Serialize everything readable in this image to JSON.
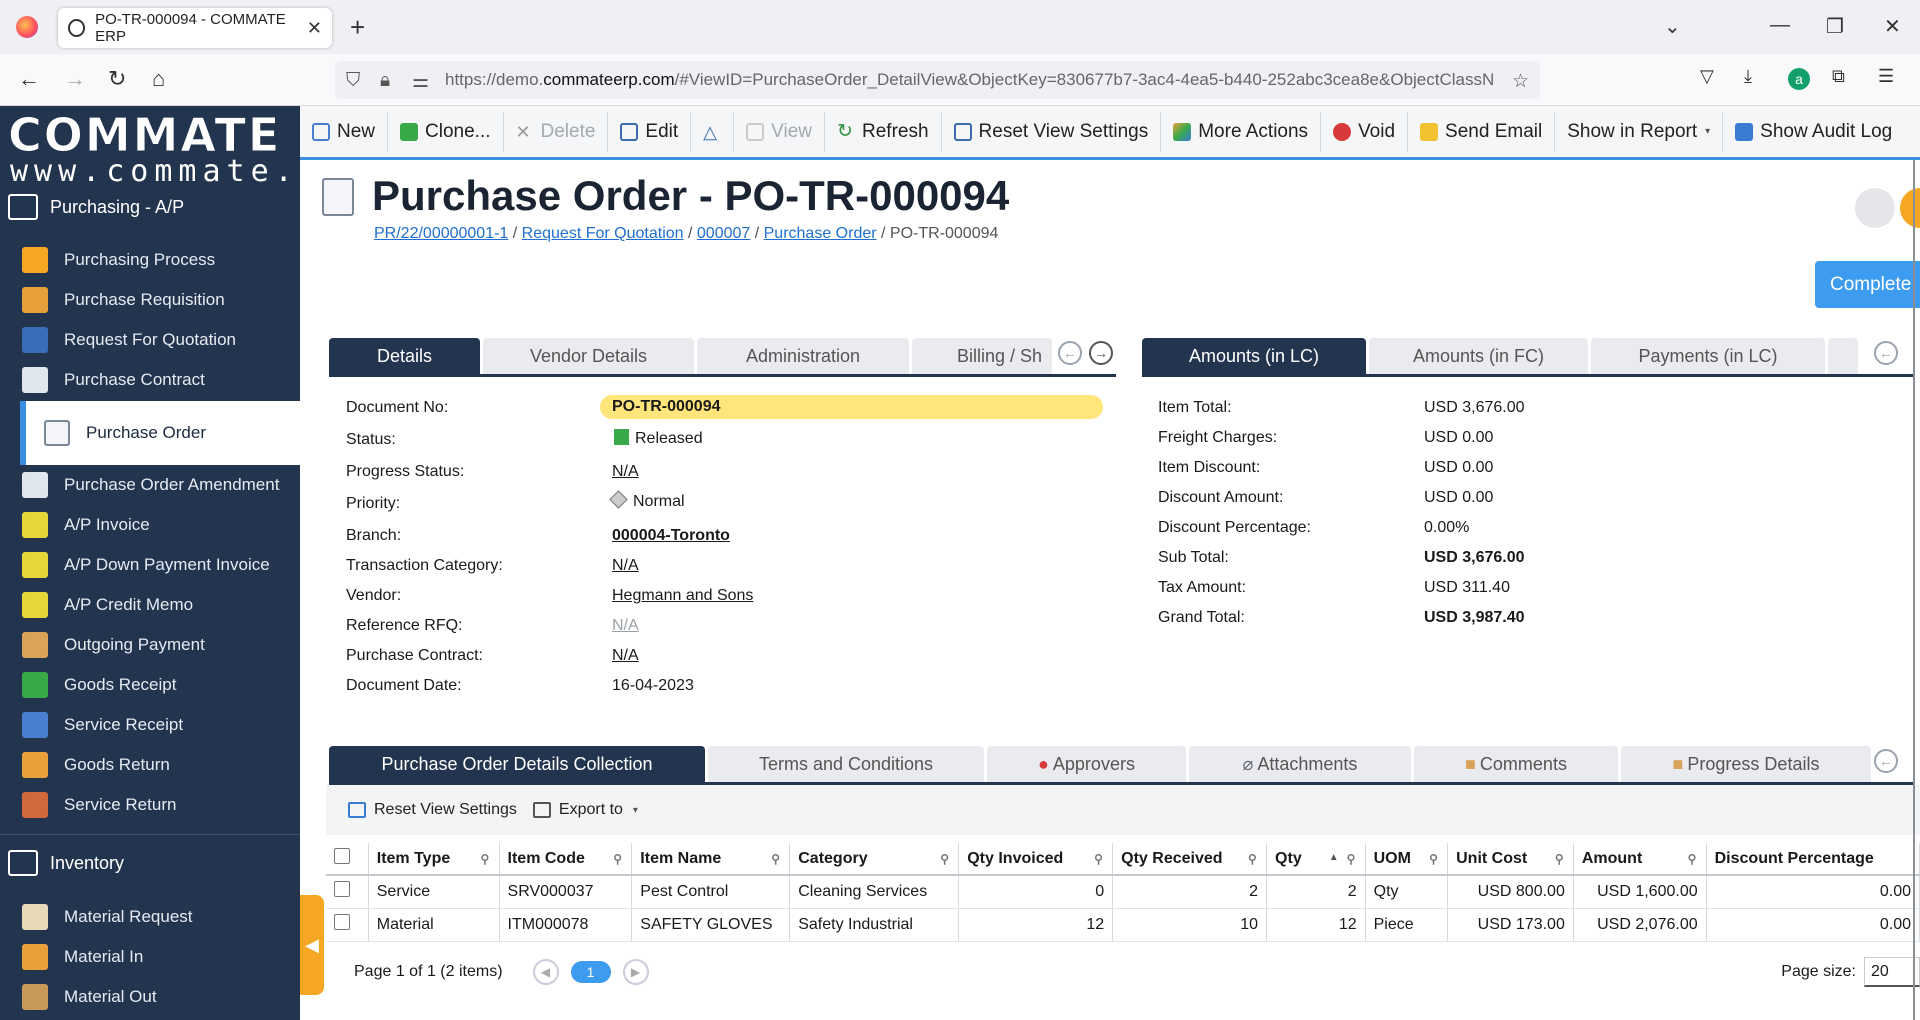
{
  "browser": {
    "tab_title": "PO-TR-000094 - COMMATE ERP",
    "url_prefix": "https://demo.",
    "url_host": "commateerp.com",
    "url_rest": "/#ViewID=PurchaseOrder_DetailView&ObjectKey=830677b7-3ac4-4ea5-b440-252abc3cea8e&ObjectClassN"
  },
  "sidebar": {
    "logo": "COMMATE",
    "logo_sub": "www.commate.ca",
    "section_purchasing": "Purchasing - A/P",
    "items": [
      {
        "label": "Purchasing Process"
      },
      {
        "label": "Purchase Requisition"
      },
      {
        "label": "Request For Quotation"
      },
      {
        "label": "Purchase Contract"
      },
      {
        "label": "Purchase Order"
      },
      {
        "label": "Purchase Order Amendment"
      },
      {
        "label": "A/P Invoice"
      },
      {
        "label": "A/P Down Payment Invoice"
      },
      {
        "label": "A/P Credit Memo"
      },
      {
        "label": "Outgoing Payment"
      },
      {
        "label": "Goods Receipt"
      },
      {
        "label": "Service Receipt"
      },
      {
        "label": "Goods Return"
      },
      {
        "label": "Service Return"
      }
    ],
    "section_inventory": "Inventory",
    "inv_items": [
      {
        "label": "Material Request"
      },
      {
        "label": "Material In"
      },
      {
        "label": "Material Out"
      }
    ]
  },
  "toolbar": {
    "new": "New",
    "clone": "Clone...",
    "delete": "Delete",
    "edit": "Edit",
    "view": "View",
    "refresh": "Refresh",
    "reset_view": "Reset View Settings",
    "more_actions": "More Actions",
    "void": "Void",
    "send_email": "Send Email",
    "show_in_report": "Show in Report",
    "show_audit_log": "Show Audit Log"
  },
  "header": {
    "title": "Purchase Order - PO-TR-000094",
    "crumbs": [
      "PR/22/00000001-1",
      "Request For Quotation",
      "000007",
      "Purchase Order"
    ],
    "crumb_current": "PO-TR-000094",
    "complete_label": "Complete"
  },
  "left_tabs": [
    "Details",
    "Vendor Details",
    "Administration",
    "Billing / Sh"
  ],
  "right_tabs": [
    "Amounts (in LC)",
    "Amounts (in FC)",
    "Payments (in LC)"
  ],
  "details": {
    "document_no_label": "Document No:",
    "document_no": "PO-TR-000094",
    "status_label": "Status:",
    "status": "Released",
    "progress_label": "Progress Status:",
    "progress": "N/A",
    "priority_label": "Priority:",
    "priority": "Normal",
    "branch_label": "Branch:",
    "branch": "000004-Toronto",
    "txn_cat_label": "Transaction Category:",
    "txn_cat": "N/A",
    "vendor_label": "Vendor:",
    "vendor": "Hegmann and Sons",
    "ref_rfq_label": "Reference RFQ:",
    "ref_rfq": "N/A",
    "contract_label": "Purchase Contract:",
    "contract": "N/A",
    "doc_date_label": "Document Date:",
    "doc_date": "16-04-2023"
  },
  "amounts": {
    "item_total_label": "Item Total:",
    "item_total": "USD 3,676.00",
    "freight_label": "Freight Charges:",
    "freight": "USD 0.00",
    "item_discount_label": "Item Discount:",
    "item_discount": "USD 0.00",
    "discount_amount_label": "Discount Amount:",
    "discount_amount": "USD 0.00",
    "discount_pct_label": "Discount Percentage:",
    "discount_pct": "0.00%",
    "sub_total_label": "Sub Total:",
    "sub_total": "USD 3,676.00",
    "tax_label": "Tax Amount:",
    "tax": "USD 311.40",
    "grand_total_label": "Grand Total:",
    "grand_total": "USD 3,987.40"
  },
  "bottom_tabs": [
    "Purchase Order Details Collection",
    "Terms and Conditions",
    "Approvers",
    "Attachments",
    "Comments",
    "Progress Details"
  ],
  "grid": {
    "reset_view": "Reset View Settings",
    "export_to": "Export to",
    "columns": [
      "Item Type",
      "Item Code",
      "Item Name",
      "Category",
      "Qty Invoiced",
      "Qty Received",
      "Qty",
      "UOM",
      "Unit Cost",
      "Amount",
      "Discount Percentage"
    ],
    "rows": [
      {
        "type": "Service",
        "code": "SRV000037",
        "name": "Pest Control",
        "category": "Cleaning Services",
        "qty_invoiced": "0",
        "qty_received": "2",
        "qty": "2",
        "uom": "Qty",
        "unit_cost": "USD 800.00",
        "amount": "USD 1,600.00",
        "discount": "0.00"
      },
      {
        "type": "Material",
        "code": "ITM000078",
        "name": "SAFETY GLOVES",
        "category": "Safety Industrial",
        "qty_invoiced": "12",
        "qty_received": "10",
        "qty": "12",
        "uom": "Piece",
        "unit_cost": "USD 173.00",
        "amount": "USD 2,076.00",
        "discount": "0.00"
      }
    ],
    "pager_text": "Page 1 of 1 (2 items)",
    "current_page": "1",
    "page_size_label": "Page size:",
    "page_size": "20"
  },
  "colors": {
    "sidebar": "#23344f",
    "accent": "#3a8de0",
    "highlight": "#ffe57a",
    "splitter": "#f5a623"
  }
}
